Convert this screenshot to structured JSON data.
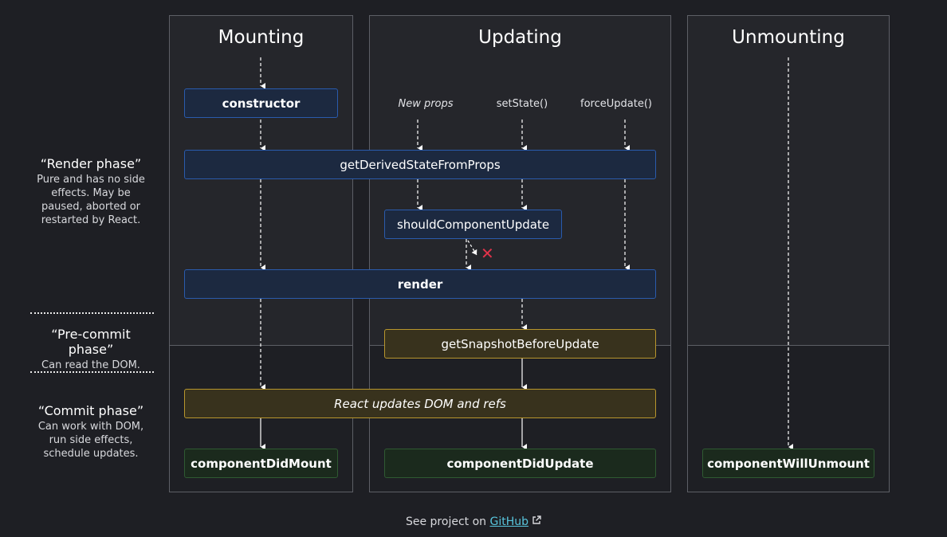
{
  "columns": {
    "mounting": "Mounting",
    "updating": "Updating",
    "unmounting": "Unmounting"
  },
  "phases": {
    "render": {
      "title": "“Render phase”",
      "description": [
        "Pure and has no side",
        "effects. May be",
        "paused, aborted or",
        "restarted by React."
      ]
    },
    "precommit": {
      "title": "“Pre-commit phase”",
      "description": [
        "Can read the DOM."
      ]
    },
    "commit": {
      "title": "“Commit phase”",
      "description": [
        "Can work with DOM,",
        "run side effects,",
        "schedule updates."
      ]
    }
  },
  "triggers": {
    "new_props": "New props",
    "set_state": "setState()",
    "force_update": "forceUpdate()"
  },
  "nodes": {
    "constructor": "constructor",
    "get_derived_state": "getDerivedStateFromProps",
    "should_component_update": "shouldComponentUpdate",
    "render": "render",
    "get_snapshot": "getSnapshotBeforeUpdate",
    "react_updates_dom": "React updates DOM and refs",
    "did_mount": "componentDidMount",
    "did_update": "componentDidUpdate",
    "will_unmount": "componentWillUnmount"
  },
  "cancel_mark": "✕",
  "footer": {
    "prefix": "See project on ",
    "link": "GitHub"
  },
  "colors": {
    "background": "#1e1f24",
    "lifecycle_blue": "#2a5bad",
    "commit_yellow": "#b8962d",
    "done_green": "#2f5a32",
    "cancel_red": "#e0334a",
    "link": "#58c4dc"
  }
}
